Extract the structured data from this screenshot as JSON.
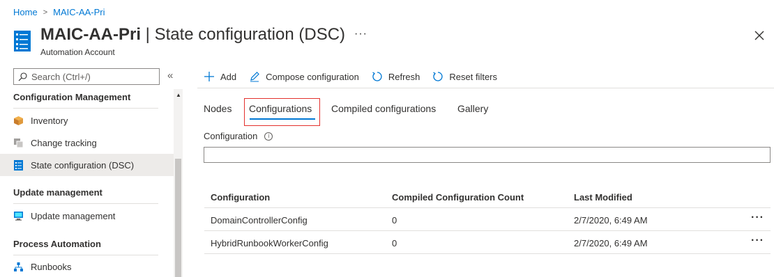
{
  "breadcrumb": {
    "home": "Home",
    "current": "MAIC-AA-Pri"
  },
  "header": {
    "title_bold": "MAIC-AA-Pri",
    "title_rest": " | State configuration (DSC)",
    "subtitle": "Automation Account",
    "more": "···"
  },
  "sidebar": {
    "search_placeholder": "Search (Ctrl+/)",
    "collapse": "«",
    "sections": [
      {
        "heading": "Configuration Management"
      },
      {
        "heading": "Update management"
      },
      {
        "heading": "Process Automation"
      }
    ],
    "items": [
      {
        "label": "Inventory",
        "icon": "inventory-icon"
      },
      {
        "label": "Change tracking",
        "icon": "change-tracking-icon"
      },
      {
        "label": "State configuration (DSC)",
        "icon": "dsc-icon",
        "active": true
      },
      {
        "label": "Update management",
        "icon": "update-management-icon"
      },
      {
        "label": "Runbooks",
        "icon": "runbooks-icon"
      }
    ]
  },
  "toolbar": {
    "add": "Add",
    "compose": "Compose configuration",
    "refresh": "Refresh",
    "reset": "Reset filters"
  },
  "tabs": {
    "nodes": "Nodes",
    "configurations": "Configurations",
    "compiled": "Compiled configurations",
    "gallery": "Gallery",
    "active": "Configurations"
  },
  "filter": {
    "label": "Configuration",
    "value": ""
  },
  "table": {
    "headers": [
      "Configuration",
      "Compiled Configuration Count",
      "Last Modified"
    ],
    "rows": [
      {
        "name": "DomainControllerConfig",
        "count": "0",
        "modified": "2/7/2020, 6:49 AM"
      },
      {
        "name": "HybridRunbookWorkerConfig",
        "count": "0",
        "modified": "2/7/2020, 6:49 AM"
      }
    ],
    "row_more": "···"
  },
  "colors": {
    "accent": "#0078d4",
    "highlight": "#e3312d",
    "active_bg": "#edebe9"
  }
}
